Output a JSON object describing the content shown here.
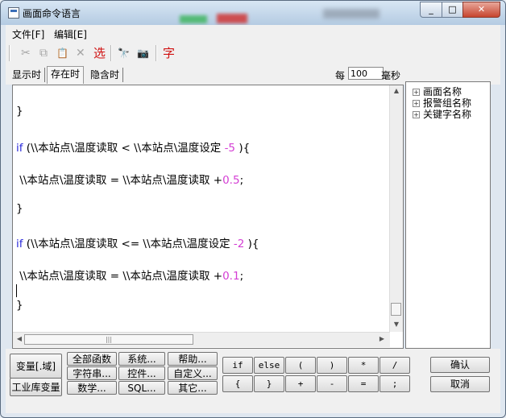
{
  "window": {
    "title": "画面命令语言",
    "minimize": "_",
    "maximize": "□",
    "close": "✕"
  },
  "menu": {
    "file": "文件[F]",
    "edit": "编辑[E]"
  },
  "toolbar": {
    "cut_icon": "✂",
    "copy_icon": "⧉",
    "paste_icon": "📋",
    "delete_icon": "✕",
    "select_label": "选",
    "find_icon": "🔭",
    "replace_icon": "📷",
    "char_label": "字"
  },
  "tabs": [
    "显示时",
    "存在时",
    "隐含时"
  ],
  "active_tab": "存在时",
  "interval": {
    "prefix": "每",
    "value": "100",
    "unit": "毫秒"
  },
  "code": {
    "close_brace_1": "}",
    "line_if1_kw": "if",
    "line_if1_text": " (\\\\本站点\\温度读取 < \\\\本站点\\温度设定 ",
    "line_if1_num": "-5",
    "line_if1_tail": " ){",
    "line_assign1_text": " \\\\本站点\\温度读取 = \\\\本站点\\温度读取 +",
    "line_assign1_num": "0.5",
    "line_assign1_tail": ";",
    "close_brace_2": "}",
    "line_if2_kw": "if",
    "line_if2_text": " (\\\\本站点\\温度读取 <= \\\\本站点\\温度设定 ",
    "line_if2_num": "-2",
    "line_if2_tail": " ){",
    "line_assign2_text": " \\\\本站点\\温度读取 = \\\\本站点\\温度读取 +",
    "line_assign2_num": "0.1",
    "line_assign2_tail": ";",
    "close_brace_3": "}"
  },
  "tree": [
    "画面名称",
    "报警组名称",
    "关键字名称"
  ],
  "buttons": {
    "variable": "变量[.域]",
    "industry_var": "工业库变量",
    "all_functions": "全部函数",
    "string": "字符串...",
    "math": "数学...",
    "system": "系统...",
    "control": "控件...",
    "sql": "SQL...",
    "help": "帮助...",
    "custom": "自定义...",
    "other": "其它...",
    "ops": [
      "if",
      "else",
      "(",
      ")",
      "*",
      "/",
      "{",
      "}",
      "+",
      "-",
      "=",
      ";"
    ],
    "ok": "确认",
    "cancel": "取消"
  },
  "colors": {
    "keyword": "#2a2adb",
    "number": "#d43ed4",
    "highlight_red": "#d01010"
  }
}
